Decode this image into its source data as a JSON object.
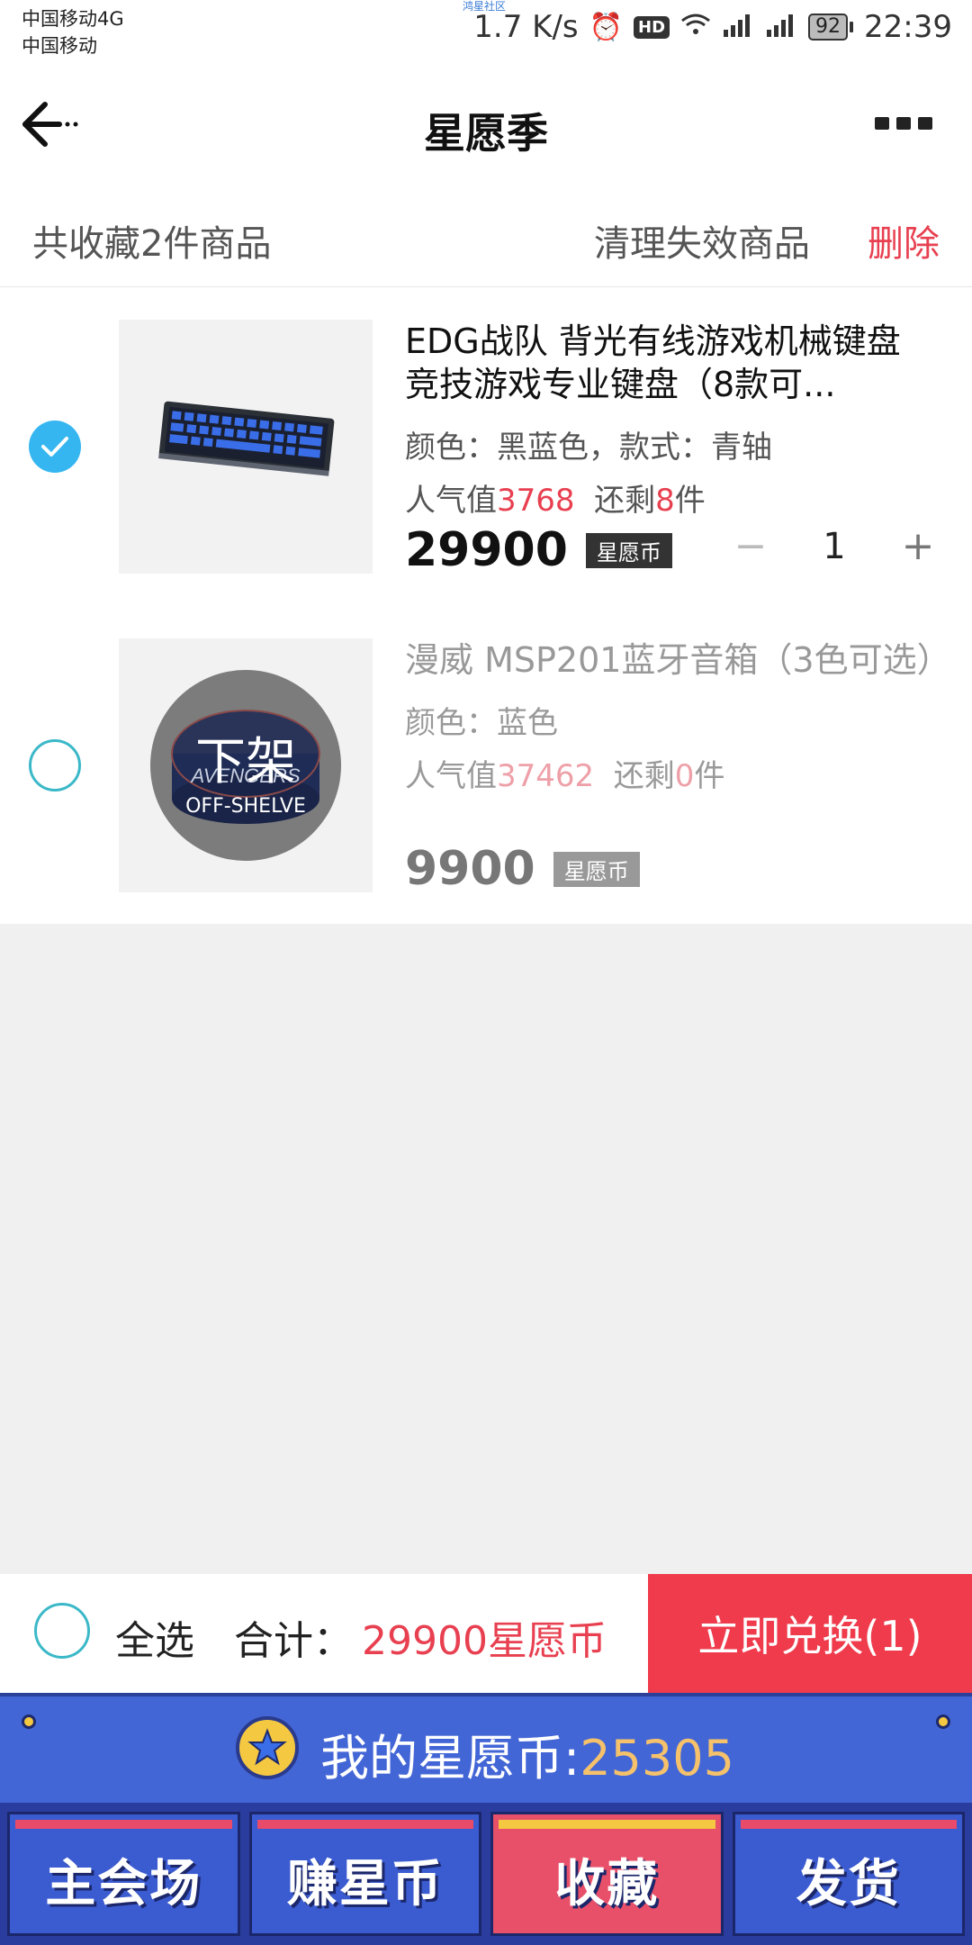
{
  "status_bar": {
    "carrier1": "中国移动4G",
    "carrier2": "中国移动",
    "community": "鸿星社区",
    "speed": "1.7 K/s",
    "hd": "HD",
    "battery": "92",
    "time": "22:39"
  },
  "nav": {
    "title": "星愿季"
  },
  "summary": {
    "count_text": "共收藏2件商品",
    "clear_label": "清理失效商品",
    "delete_label": "删除"
  },
  "items": [
    {
      "title": "EDG战队 背光有线游戏机械键盘 竞技游戏专业键盘（8款可...",
      "attr": "颜色：黑蓝色，款式：青轴",
      "pop_label": "人气值",
      "pop_value": "3768",
      "remain_label": "还剩",
      "remain_value": "8",
      "remain_unit": "件",
      "price": "29900",
      "coin_tag": "星愿币",
      "quantity": "1",
      "minus": "−",
      "plus": "+",
      "selected": true
    },
    {
      "title": "漫威 MSP201蓝牙音箱（3色可选）",
      "attr": "颜色：蓝色",
      "pop_label": "人气值",
      "pop_value": "37462",
      "remain_label": "还剩",
      "remain_value": "0",
      "remain_unit": "件",
      "price": "9900",
      "coin_tag": "星愿币",
      "overlay_cn": "下架",
      "overlay_en": "OFF-SHELVE",
      "selected": false
    }
  ],
  "checkout": {
    "select_all": "全选",
    "total_label": "合计：",
    "total_value": "29900星愿币",
    "exchange_button": "立即兑换(1)"
  },
  "coinbar": {
    "label": "我的星愿币:",
    "value": "25305"
  },
  "tabs": [
    "主会场",
    "赚星币",
    "收藏",
    "发货"
  ],
  "colors": {
    "accent_red": "#e84050",
    "check_blue": "#36b6f0",
    "banner_blue": "#4366d6",
    "coin_gold": "#f5c26b"
  }
}
